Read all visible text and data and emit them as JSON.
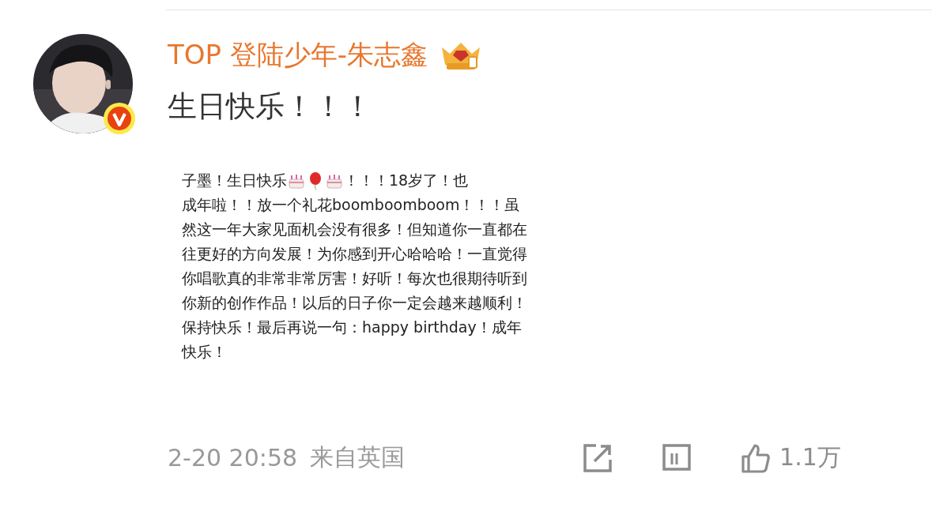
{
  "post": {
    "author": "TOP 登陆少年-朱志鑫",
    "verified": true,
    "text": "生日快乐！！！",
    "note": {
      "lead": [
        {
          "kind": "text",
          "text": "子墨！生日快乐"
        },
        {
          "kind": "cake"
        },
        {
          "kind": "balloon"
        },
        {
          "kind": "cake"
        },
        {
          "kind": "text",
          "text": "！！！18岁了！也"
        }
      ],
      "text": "成年啦！！放一个礼花boomboomboom！！！虽然这一年大家见面机会没有很多！但知道你一直都在往更好的方向发展！为你感到开心哈哈哈！一直觉得你唱歌真的非常非常厉害！好听！每次也很期待听到你新的创作作品！以后的日子你一定会越来越顺利！保持快乐！最后再说一句：happy birthday！成年快乐！"
    },
    "time": "2-20 20:58",
    "source": "来自英国",
    "likes": "1.1万"
  }
}
